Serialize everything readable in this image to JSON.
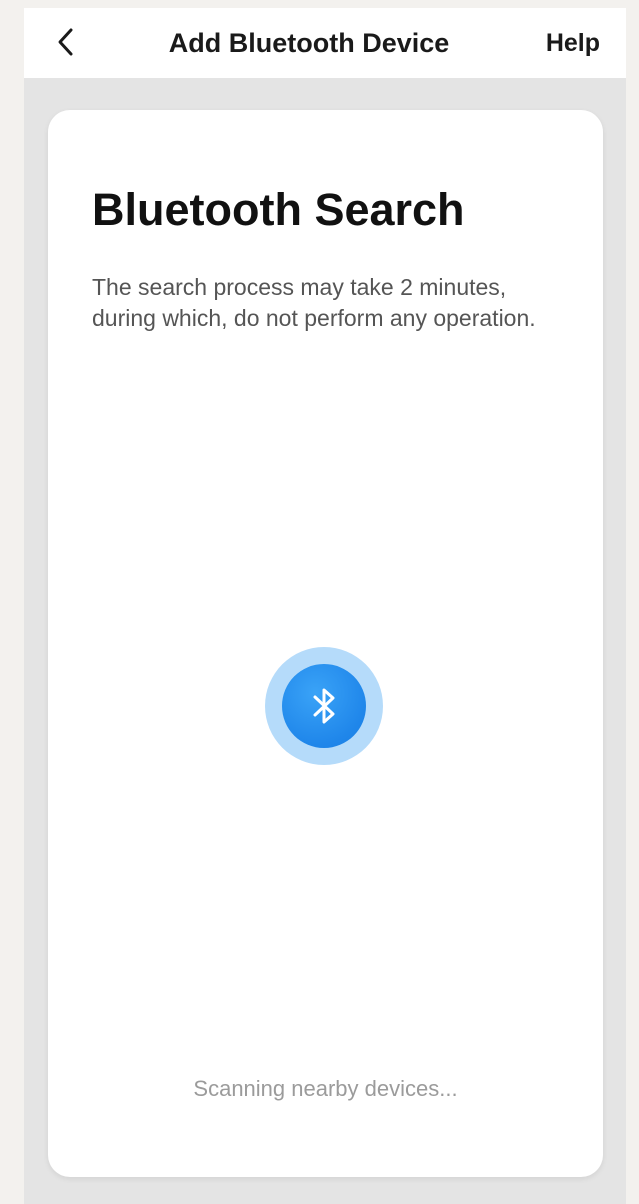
{
  "nav": {
    "title": "Add Bluetooth Device",
    "help_label": "Help",
    "back_icon": "chevron-left-icon"
  },
  "card": {
    "title": "Bluetooth Search",
    "description": "The search process may take 2 minutes, during which, do not perform any operation.",
    "status_text": "Scanning nearby devices...",
    "scan_icon": "bluetooth-icon"
  },
  "colors": {
    "accent": "#1f86ea",
    "ring": "#5aaff5",
    "background": "#e4e4e4",
    "card": "#ffffff"
  }
}
